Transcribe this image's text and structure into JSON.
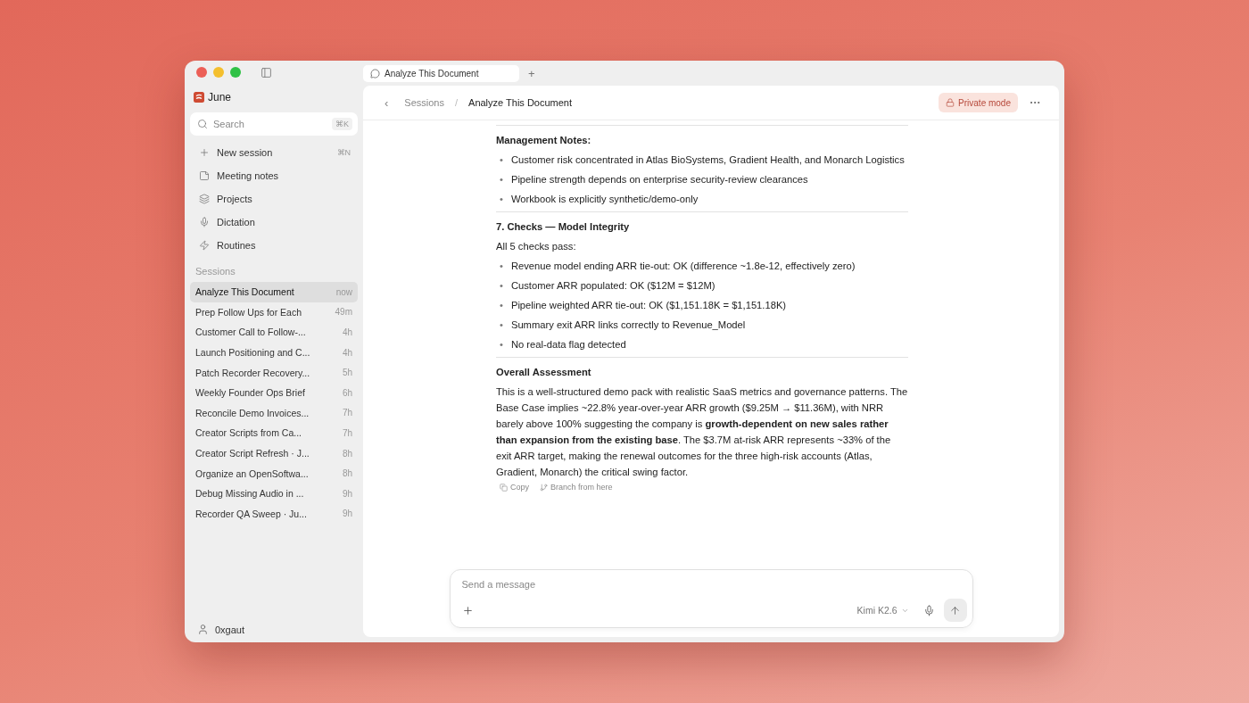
{
  "tab": {
    "title": "Analyze This Document",
    "new_tab": "+"
  },
  "sidebar": {
    "app_name": "June",
    "search": {
      "placeholder": "Search",
      "shortcut": "⌘K"
    },
    "nav": [
      {
        "label": "New session",
        "shortcut": "⌘N"
      },
      {
        "label": "Meeting notes"
      },
      {
        "label": "Projects"
      },
      {
        "label": "Dictation"
      },
      {
        "label": "Routines"
      }
    ],
    "sessions_heading": "Sessions",
    "sessions": [
      {
        "title": "Analyze This Document",
        "time": "now",
        "selected": true
      },
      {
        "title": "Prep Follow Ups for Each",
        "time": "49m",
        "selected": false
      },
      {
        "title": "Customer Call to Follow-...",
        "time": "4h",
        "selected": false
      },
      {
        "title": "Launch Positioning and C...",
        "time": "4h",
        "selected": false
      },
      {
        "title": "Patch Recorder Recovery...",
        "time": "5h",
        "selected": false
      },
      {
        "title": "Weekly Founder Ops Brief",
        "time": "6h",
        "selected": false
      },
      {
        "title": "Reconcile Demo Invoices...",
        "time": "7h",
        "selected": false
      },
      {
        "title": "Creator Scripts from Ca...",
        "time": "7h",
        "selected": false
      },
      {
        "title": "Creator Script Refresh · J...",
        "time": "8h",
        "selected": false
      },
      {
        "title": "Organize an OpenSoftwa...",
        "time": "8h",
        "selected": false
      },
      {
        "title": "Debug Missing Audio in ...",
        "time": "9h",
        "selected": false
      },
      {
        "title": "Recorder QA Sweep · Ju...",
        "time": "9h",
        "selected": false
      }
    ],
    "user": "0xgaut"
  },
  "header": {
    "back": "‹",
    "breadcrumb": [
      "Sessions",
      "Analyze This Document"
    ],
    "separator": "/",
    "private_mode": "Private mode"
  },
  "content": [
    {
      "kind": "divider"
    },
    {
      "kind": "heading",
      "text": "Management Notes:"
    },
    {
      "kind": "bullets",
      "marker": "•",
      "items": [
        "Customer risk concentrated in Atlas BioSystems, Gradient Health, and Monarch Logistics",
        "Pipeline strength depends on enterprise security-review clearances",
        "Workbook is explicitly synthetic/demo-only"
      ]
    },
    {
      "kind": "divider"
    },
    {
      "kind": "heading",
      "text": "7. Checks — Model Integrity"
    },
    {
      "kind": "paragraph",
      "text": "All 5 checks pass:"
    },
    {
      "kind": "bullets",
      "marker": "•",
      "items": [
        "Revenue model ending ARR tie-out: OK (difference ~1.8e-12, effectively zero)",
        "Customer ARR populated: OK ($12M = $12M)",
        "Pipeline weighted ARR tie-out: OK ($1,151.18K = $1,151.18K)",
        "Summary exit ARR links correctly to Revenue_Model",
        "No real-data flag detected"
      ]
    },
    {
      "kind": "divider"
    },
    {
      "kind": "heading",
      "text": "Overall Assessment"
    },
    {
      "kind": "paragraph",
      "text": "This is a well-structured demo pack with realistic SaaS metrics and governance patterns. The Base Case implies ~22.8% year-over-year ARR growth ($9.25M → $11.36M), with NRR barely above 100% suggesting the company is **growth-dependent on new sales rather than expansion from the existing base**. The $3.7M at-risk ARR represents ~33% of the exit ARR target, making the renewal outcomes for the three high-risk accounts (Atlas, Gradient, Monarch) the critical swing factor."
    }
  ],
  "actions": [
    "Copy",
    "Branch from here"
  ],
  "composer": {
    "placeholder": "Send a message",
    "model": "Kimi K2.6"
  }
}
